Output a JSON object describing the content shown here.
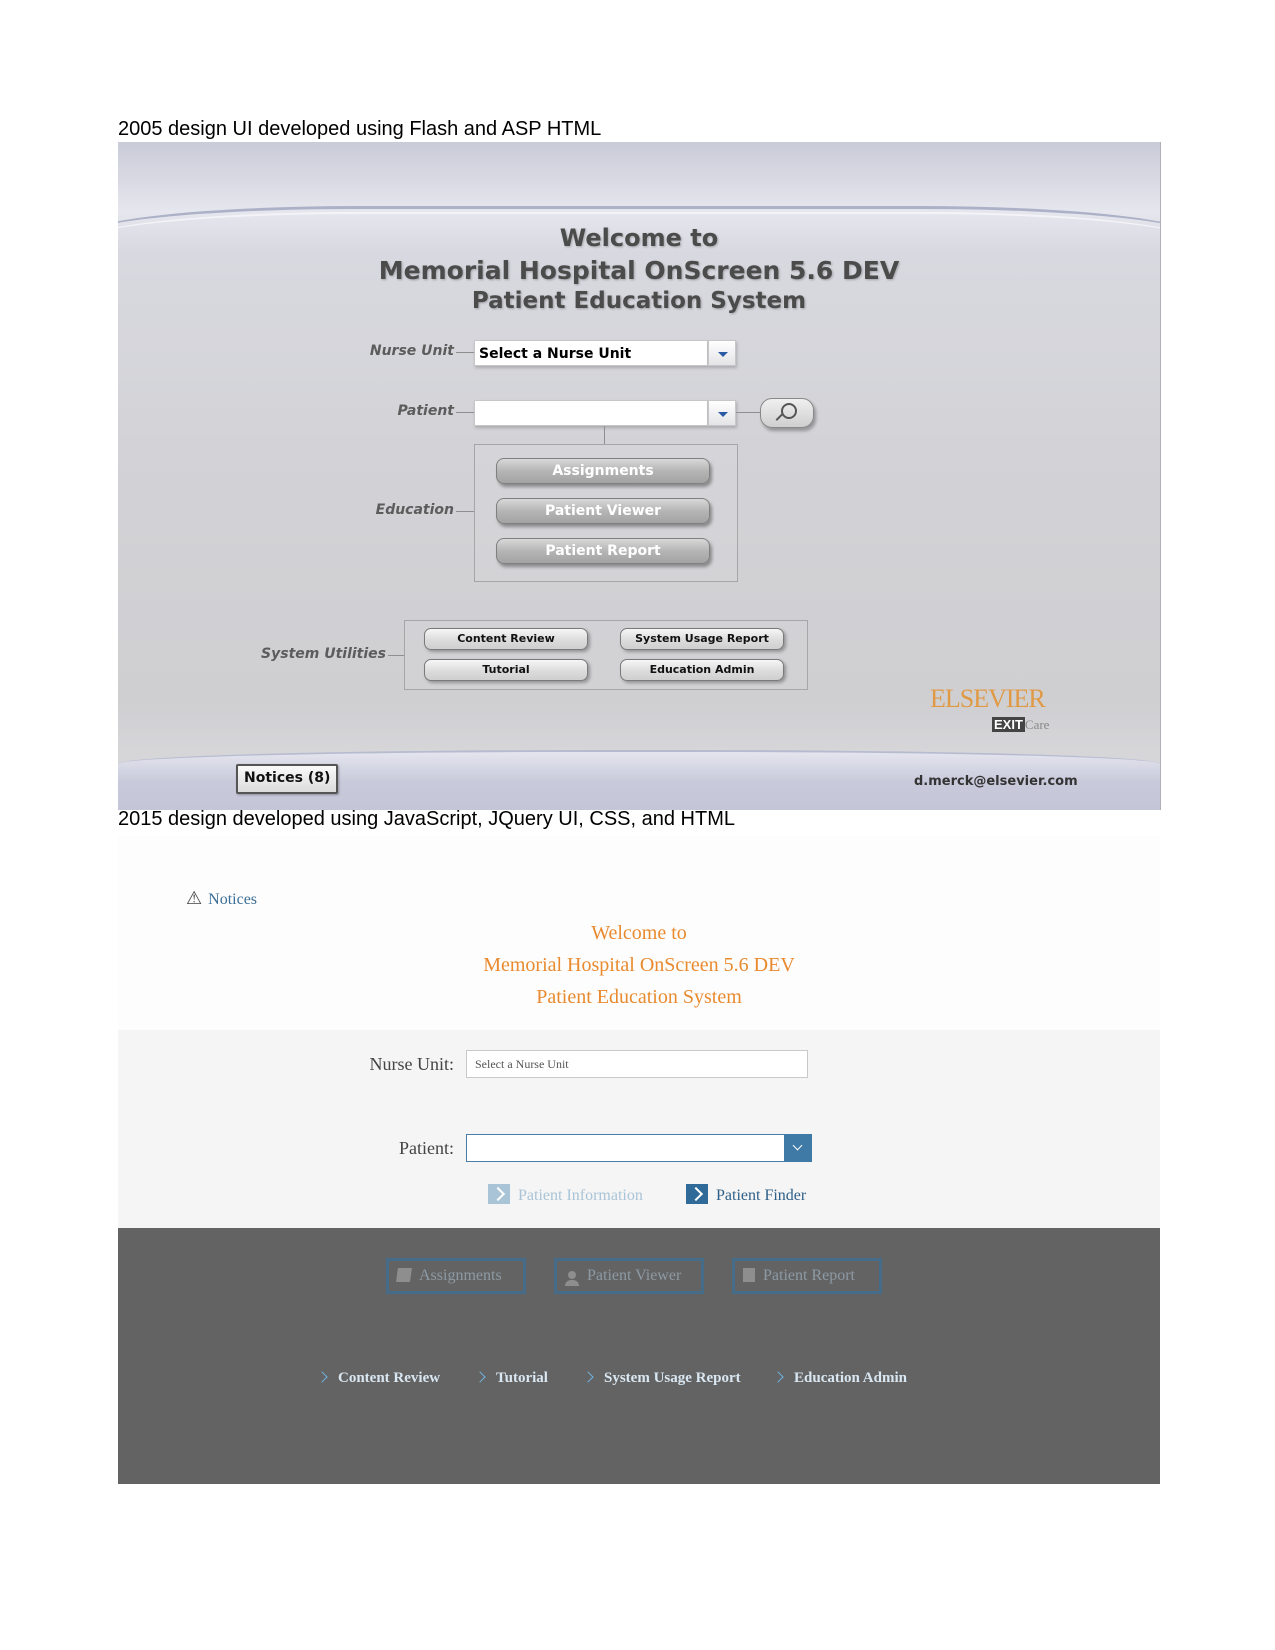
{
  "captions": {
    "old": "2005 design UI developed using Flash and ASP HTML",
    "new": "2015 design developed using JavaScript, JQuery UI, CSS, and HTML"
  },
  "old_ui": {
    "title_line1": "Welcome to",
    "title_line2": "Memorial Hospital OnScreen 5.6 DEV",
    "title_line3": "Patient Education System",
    "nurse_unit_label": "Nurse Unit",
    "nurse_unit_value": "Select a Nurse Unit",
    "patient_label": "Patient",
    "patient_value": "",
    "education_label": "Education",
    "education_buttons": [
      "Assignments",
      "Patient Viewer",
      "Patient Report"
    ],
    "system_utilities_label": "System Utilities",
    "utility_buttons": [
      "Content Review",
      "System Usage Report",
      "Tutorial",
      "Education Admin"
    ],
    "notices_button": "Notices (8)",
    "user_email": "d.merck@elsevier.com",
    "logo_text": "ELSEVIER",
    "logo_sub_exit": "EXIT",
    "logo_sub_care": "Care"
  },
  "new_ui": {
    "notices_link": "Notices",
    "title_line1": "Welcome to",
    "title_line2": "Memorial Hospital OnScreen 5.6 DEV",
    "title_line3": "Patient Education System",
    "nurse_unit_label": "Nurse Unit:",
    "nurse_unit_value": "Select a Nurse Unit",
    "patient_label": "Patient:",
    "patient_value": "",
    "patient_information_link": "Patient Information",
    "patient_finder_link": "Patient Finder",
    "education_buttons": [
      "Assignments",
      "Patient Viewer",
      "Patient Report"
    ],
    "utility_links": [
      "Content Review",
      "Tutorial",
      "System Usage Report",
      "Education Admin"
    ]
  },
  "colors": {
    "new_title": "#e98a2f",
    "new_link": "#2d5f88",
    "new_footer_bg": "#636363",
    "logo": "#e09a46"
  }
}
